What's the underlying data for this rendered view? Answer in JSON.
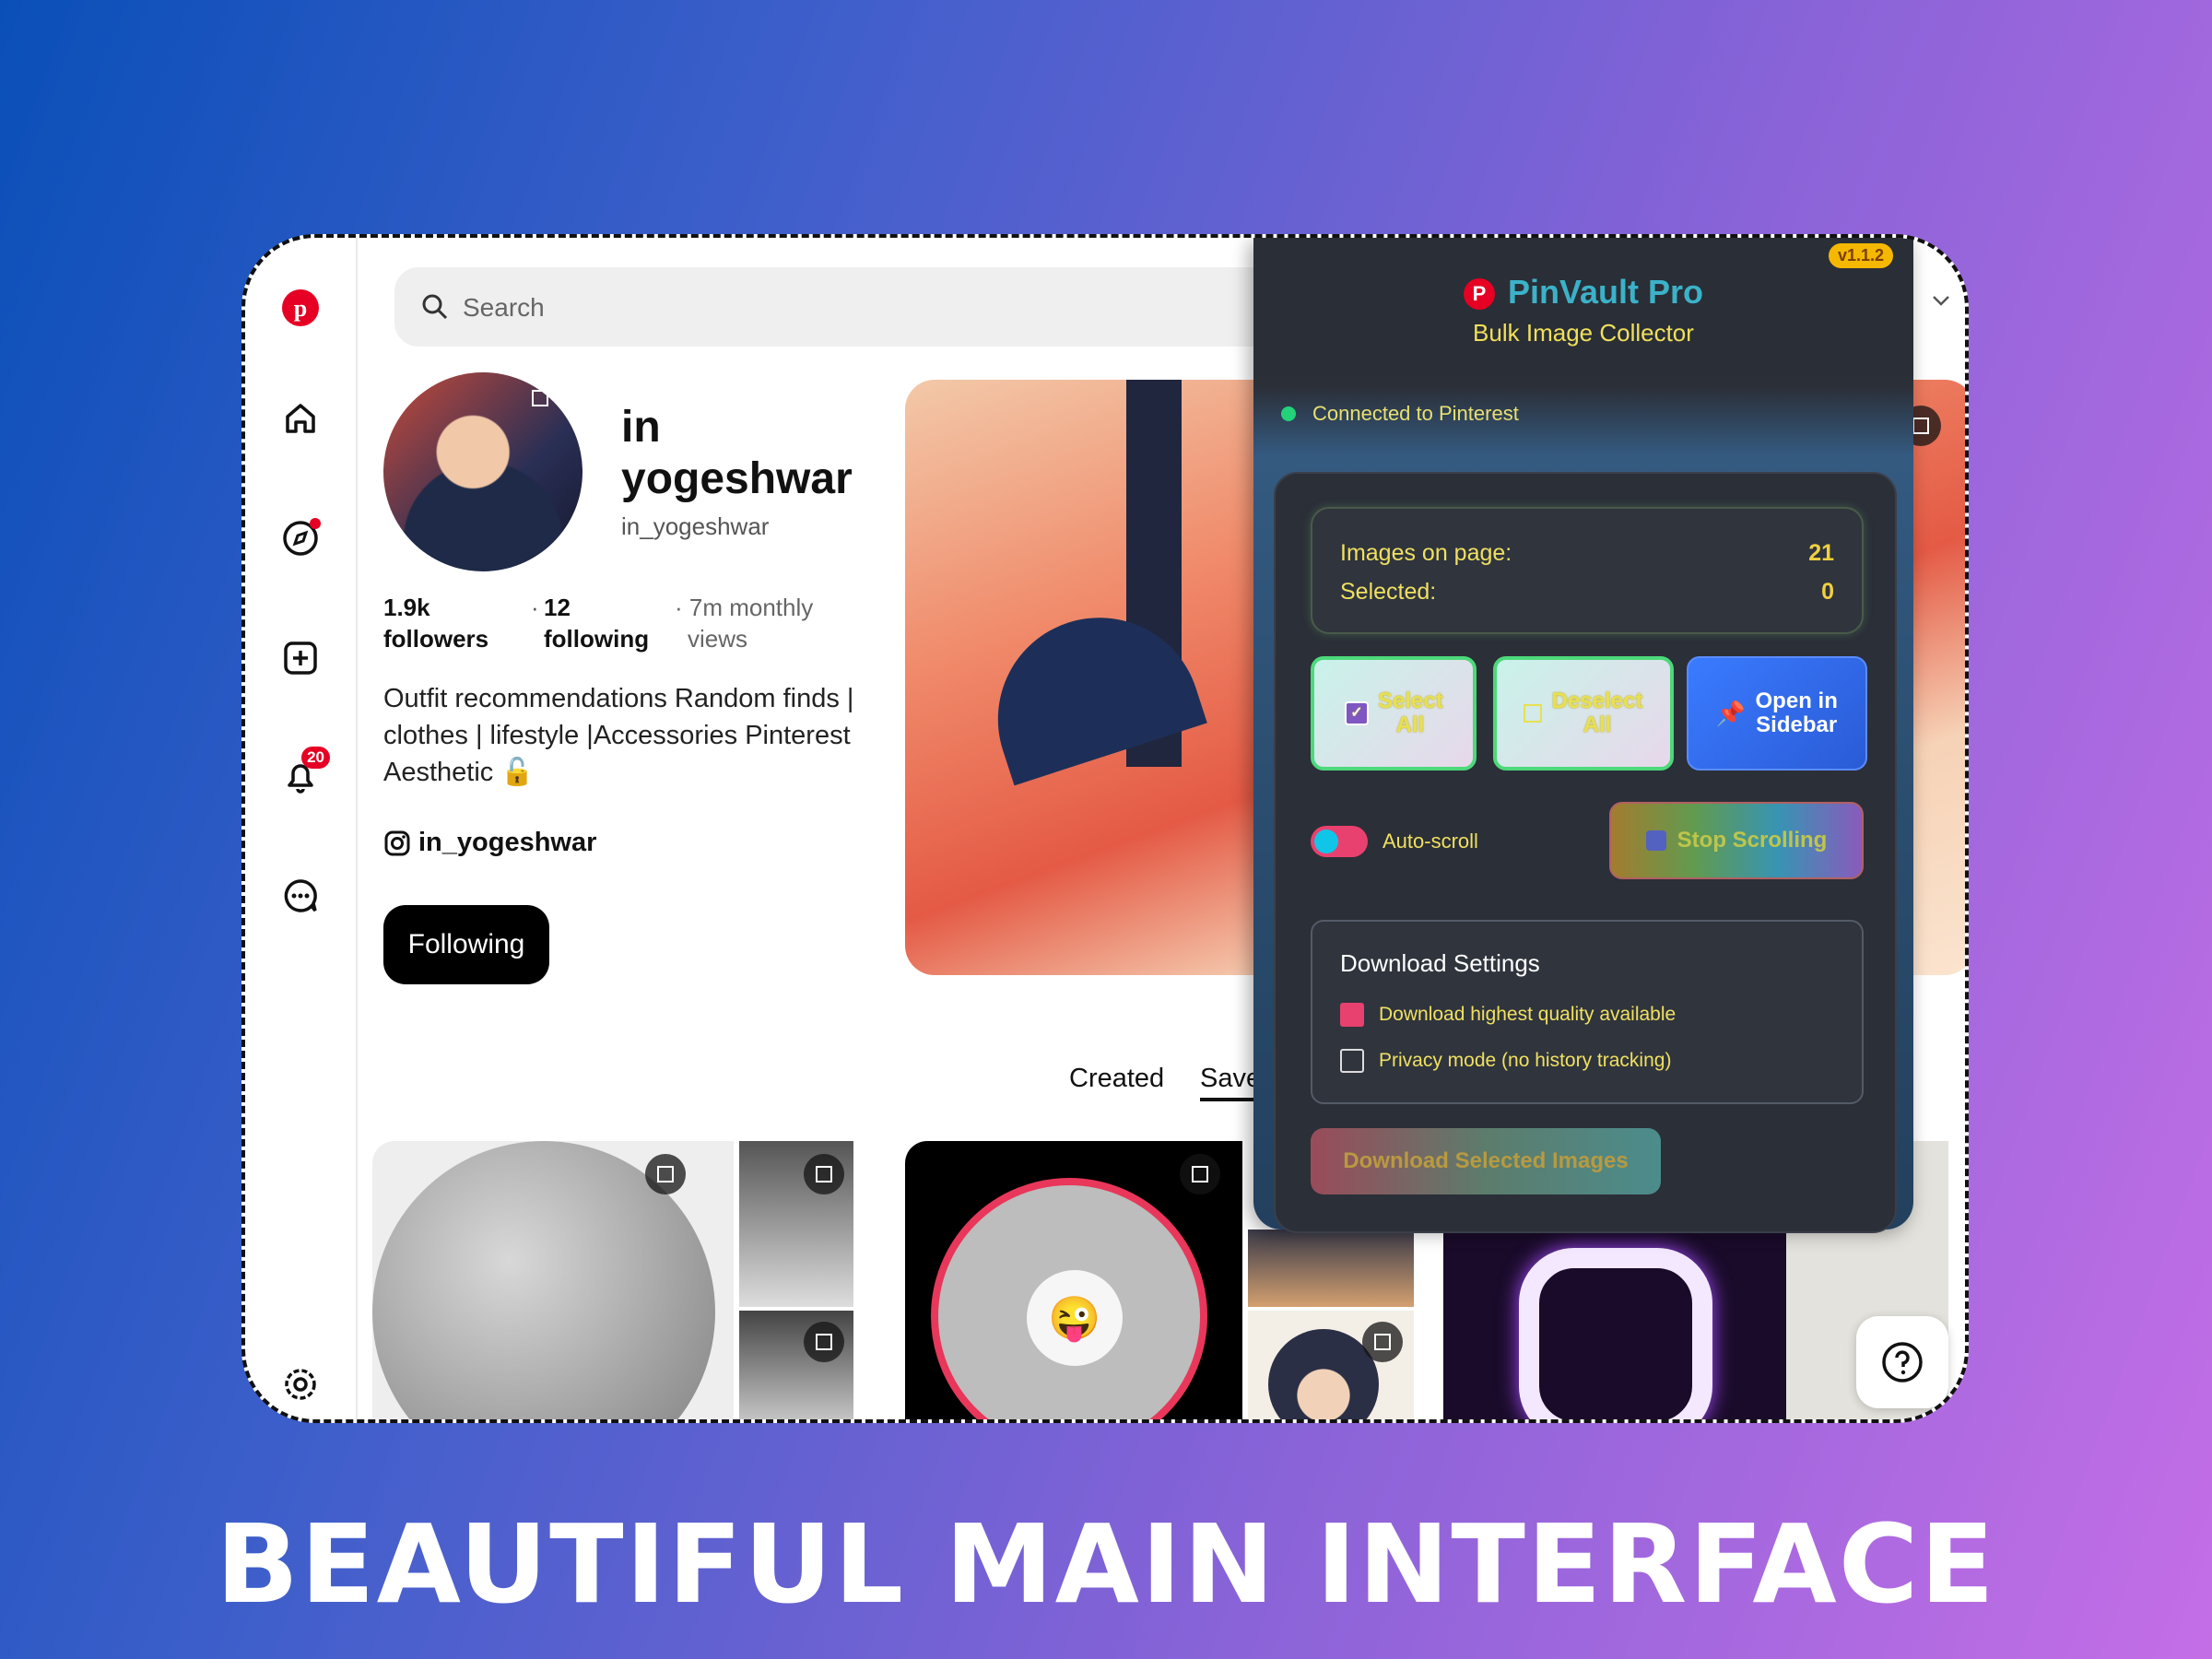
{
  "headline": "BEAUTIFUL MAIN INTERFACE",
  "search": {
    "placeholder": "Search"
  },
  "rail": {
    "notification_count": "20"
  },
  "profile": {
    "name_line1": "in",
    "name_line2": "yogeshwar",
    "handle": "in_yogeshwar",
    "followers_count": "1.9k",
    "followers_label": "followers",
    "following_count": "12",
    "following_label": "following",
    "monthly_views": "· 7m monthly",
    "monthly_views_2": "views",
    "bio": "Outfit recommendations Random finds | clothes | lifestyle |Accessories Pinterest Aesthetic 🔓",
    "instagram": "in_yogeshwar",
    "follow_button": "Following"
  },
  "tabs": {
    "created": "Created",
    "saved": "Save"
  },
  "panel": {
    "version": "v1.1.2",
    "title": "PinVault Pro",
    "subtitle": "Bulk Image Collector",
    "connection_status": "Connected to Pinterest",
    "images_label": "Images on page:",
    "images_value": "21",
    "selected_label": "Selected:",
    "selected_value": "0",
    "select_all": "Select All",
    "deselect_all": "Deselect All",
    "open_sidebar": "Open in Sidebar",
    "autoscroll_label": "Auto-scroll",
    "stop_scrolling": "Stop Scrolling",
    "download_settings_title": "Download Settings",
    "opt_quality": "Download highest quality available",
    "opt_privacy": "Privacy mode (no history tracking)",
    "download_button": "Download Selected Images"
  },
  "colors": {
    "pinterest_red": "#e60023",
    "panel_bg": "#2b2f38",
    "accent_yellow": "#f0e060"
  }
}
